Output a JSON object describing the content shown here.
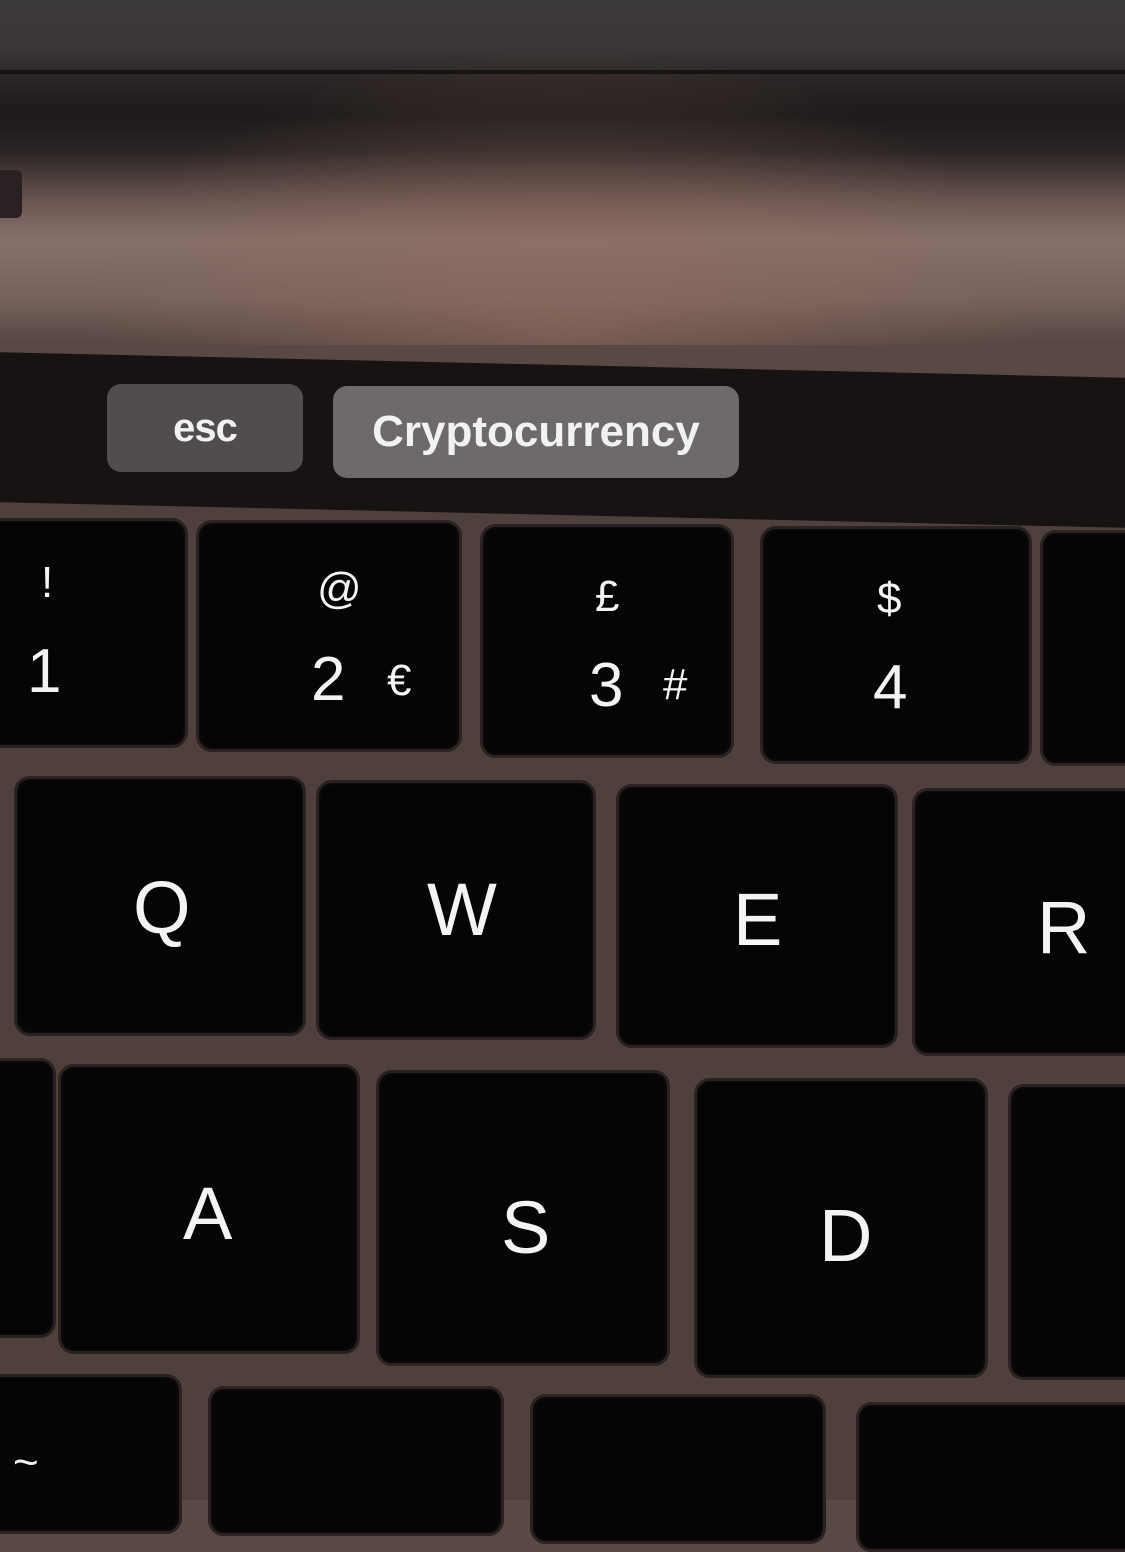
{
  "touch_bar": {
    "esc_label": "esc",
    "app_label": "Cryptocurrency"
  },
  "keys": {
    "k1": {
      "shift": "!",
      "main": "1"
    },
    "k2": {
      "shift": "@",
      "main": "2",
      "alt": "€"
    },
    "k3": {
      "shift": "£",
      "main": "3",
      "alt": "#"
    },
    "k4": {
      "shift": "$",
      "main": "4"
    },
    "q": "Q",
    "w": "W",
    "e": "E",
    "r": "R",
    "a": "A",
    "s": "S",
    "d": "D",
    "tilde": "~"
  }
}
